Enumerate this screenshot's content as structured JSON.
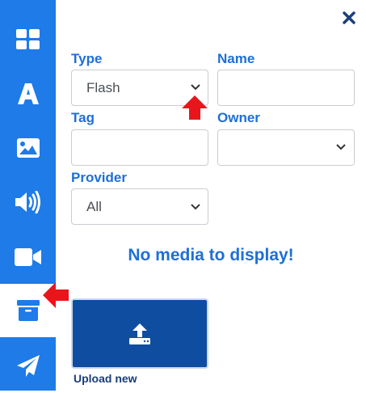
{
  "sidebar": {
    "items": [
      {
        "icon": "grid-icon"
      },
      {
        "icon": "text-icon"
      },
      {
        "icon": "image-icon"
      },
      {
        "icon": "audio-icon"
      },
      {
        "icon": "video-icon"
      },
      {
        "icon": "archive-icon",
        "active": true
      },
      {
        "icon": "send-icon"
      }
    ]
  },
  "filters": {
    "type": {
      "label": "Type",
      "value": "Flash"
    },
    "name": {
      "label": "Name",
      "value": ""
    },
    "tag": {
      "label": "Tag",
      "value": ""
    },
    "owner": {
      "label": "Owner",
      "value": ""
    },
    "provider": {
      "label": "Provider",
      "value": "All"
    }
  },
  "empty_message": "No media to display!",
  "upload": {
    "label": "Upload new"
  },
  "colors": {
    "sidebar": "#1e7be8",
    "accent": "#1e6fd6",
    "upload_bg": "#0f4da0",
    "annotation_arrow": "#e8161b"
  }
}
